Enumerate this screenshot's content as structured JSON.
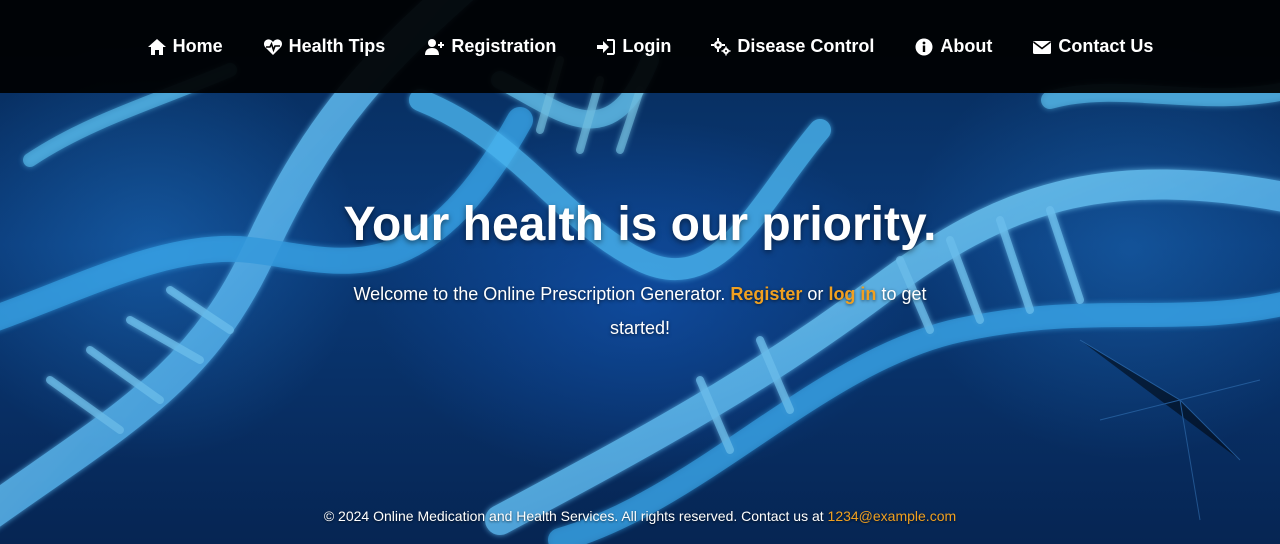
{
  "nav": {
    "items": [
      {
        "label": "Home",
        "icon": "home-icon"
      },
      {
        "label": "Health Tips",
        "icon": "heartbeat-icon"
      },
      {
        "label": "Registration",
        "icon": "user-plus-icon"
      },
      {
        "label": "Login",
        "icon": "sign-in-icon"
      },
      {
        "label": "Disease Control",
        "icon": "cogs-icon"
      },
      {
        "label": "About",
        "icon": "info-circle-icon"
      },
      {
        "label": "Contact Us",
        "icon": "envelope-icon"
      }
    ]
  },
  "hero": {
    "title": "Your health is our priority.",
    "text_before": "Welcome to the Online Prescription Generator.",
    "register_link": "Register",
    "text_or": "or",
    "login_link": "log in",
    "text_after": "to get started!"
  },
  "footer": {
    "text": "© 2024 Online Medication and Health Services. All rights reserved. Contact us at",
    "email": "1234@example.com"
  },
  "colors": {
    "accent": "#f0a020",
    "navbar": "#000000",
    "background": "#0a3a78"
  }
}
